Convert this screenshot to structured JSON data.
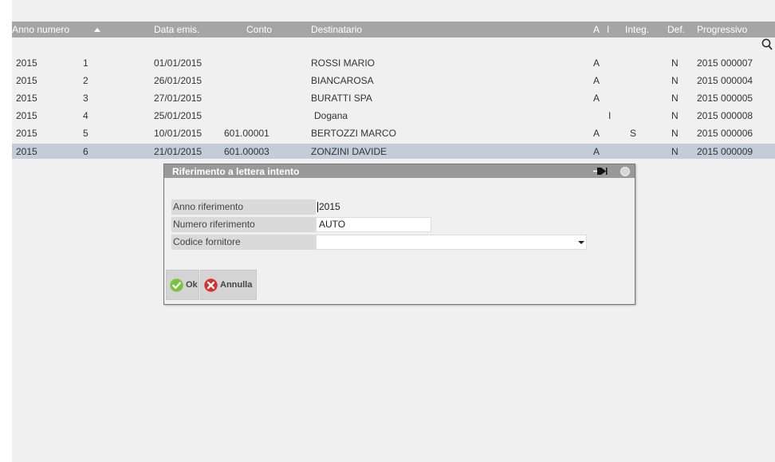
{
  "table": {
    "headers": {
      "anno_numero": "Anno numero",
      "data_emis": "Data emis.",
      "conto": "Conto",
      "destinatario": "Destinatario",
      "a": "A",
      "i": "I",
      "integ": "Integ.",
      "def": "Def.",
      "progressivo": "Progressivo"
    },
    "rows": [
      {
        "anno": "2015",
        "numero": "1",
        "data": "01/01/2015",
        "conto": "",
        "destinatario": "ROSSI MARIO",
        "a": "A",
        "i": "",
        "integ": "",
        "def": "N",
        "progressivo": "2015 000007"
      },
      {
        "anno": "2015",
        "numero": "2",
        "data": "26/01/2015",
        "conto": "",
        "destinatario": "BIANCAROSA",
        "a": "A",
        "i": "",
        "integ": "",
        "def": "N",
        "progressivo": "2015 000004"
      },
      {
        "anno": "2015",
        "numero": "3",
        "data": "27/01/2015",
        "conto": "",
        "destinatario": "BURATTI SPA",
        "a": "A",
        "i": "",
        "integ": "",
        "def": "N",
        "progressivo": "2015 000005"
      },
      {
        "anno": "2015",
        "numero": "4",
        "data": "25/01/2015",
        "conto": "",
        "destinatario": "Dogana",
        "a": "",
        "i": "I",
        "integ": "",
        "def": "N",
        "progressivo": "2015 000008"
      },
      {
        "anno": "2015",
        "numero": "5",
        "data": "10/01/2015",
        "conto": "601.00001",
        "destinatario": "BERTOZZI MARCO",
        "a": "A",
        "i": "",
        "integ": "S",
        "def": "N",
        "progressivo": "2015 000006"
      },
      {
        "anno": "2015",
        "numero": "6",
        "data": "21/01/2015",
        "conto": "601.00003",
        "destinatario": "ZONZINI DAVIDE",
        "a": "A",
        "i": "",
        "integ": "",
        "def": "N",
        "progressivo": "2015 000009"
      }
    ],
    "selected_row": 5
  },
  "dialog": {
    "title": "Riferimento a lettera intento",
    "fields": {
      "anno_label": "Anno riferimento",
      "anno_value": "2015",
      "numero_label": "Numero riferimento",
      "numero_value": "AUTO",
      "codice_label": "Codice fornitore",
      "codice_value": ""
    },
    "buttons": {
      "ok": "Ok",
      "annulla": "Annulla"
    }
  },
  "icons": {
    "sort": "sort-ascending-icon",
    "search": "search-icon",
    "pin": "pin-icon",
    "window": "window-circle-icon",
    "ok": "check-circle-icon",
    "cancel": "x-circle-icon",
    "dropdown": "chevron-down-icon"
  },
  "colors": {
    "header_bg": "#a5a5a5",
    "app_bg": "#f0f0f0",
    "selected_row": "#c4ccd8",
    "dialog_title_bg": "#999999",
    "ok_green": "#7cc242",
    "cancel_red": "#d8302a"
  }
}
